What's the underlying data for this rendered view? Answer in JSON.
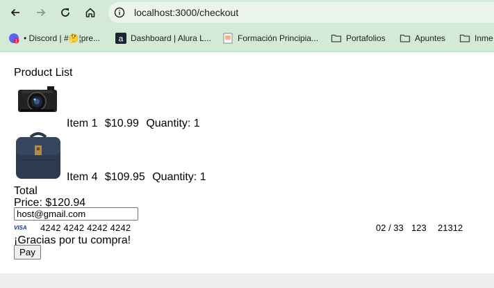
{
  "browser": {
    "url": "localhost:3000/checkout",
    "bookmarks": [
      {
        "label": "• Discord | #🤔¦pre...",
        "icon": "discord-icon"
      },
      {
        "label": "Dashboard | Alura L...",
        "icon": "alura-icon"
      },
      {
        "label": "Formación Principia...",
        "icon": "page-icon"
      },
      {
        "label": "Portafolios",
        "icon": "folder-icon"
      },
      {
        "label": "Apuntes",
        "icon": "folder-icon"
      },
      {
        "label": "Inme",
        "icon": "folder-icon"
      }
    ]
  },
  "page": {
    "heading": "Product List",
    "products": [
      {
        "name": "Item 1",
        "price": "$10.99",
        "quantity": "Quantity: 1",
        "image": "camera"
      },
      {
        "name": "Item 4",
        "price": "$109.95",
        "quantity": "Quantity: 1",
        "image": "backpack"
      }
    ],
    "total_label": "Total",
    "price_label": "Price: $120.94",
    "email_value": "host@gmail.com",
    "card": {
      "brand": "VISA",
      "number": "4242 4242 4242 4242",
      "expiry": "02 / 33",
      "cvc": "123",
      "zip": "21312"
    },
    "thanks": "¡Gracias por tu compra!",
    "pay_label": "Pay"
  }
}
